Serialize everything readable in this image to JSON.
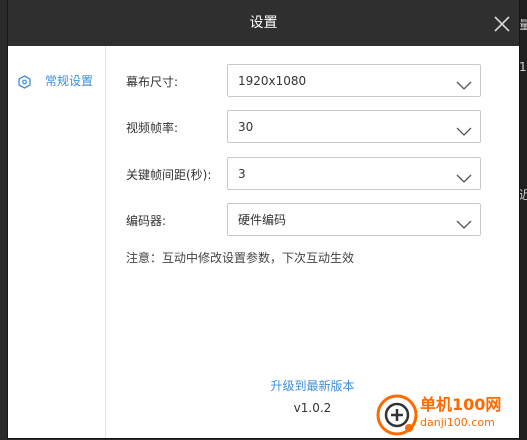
{
  "dialog": {
    "title": "设置",
    "close_icon": "close-icon"
  },
  "sidebar": {
    "items": [
      {
        "label": "常规设置",
        "icon": "hexagon-settings-icon",
        "active": true
      }
    ]
  },
  "form": {
    "fields": [
      {
        "label": "幕布尺寸:",
        "value": "1920x1080"
      },
      {
        "label": "视频帧率:",
        "value": "30"
      },
      {
        "label": "关键帧间距(秒):",
        "value": "3"
      },
      {
        "label": "编码器:",
        "value": "硬件编码"
      }
    ],
    "note": "注意：互动中修改设置参数，下次互动生效"
  },
  "footer": {
    "upgrade_link": "升级到最新版本",
    "version": "v1.0.2"
  },
  "watermark": {
    "text": "单机100网",
    "subtext": "danji100.com"
  },
  "colors": {
    "accent": "#3b8fd9",
    "titlebar": "#2f2f2f",
    "watermark": "#ff6a00"
  },
  "background": {
    "partial_chars": [
      "量",
      "1",
      "近"
    ]
  }
}
